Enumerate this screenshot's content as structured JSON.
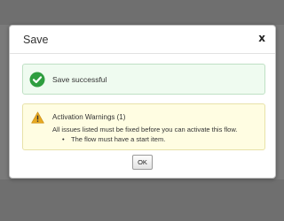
{
  "dialog": {
    "title": "Save",
    "close_label": "x"
  },
  "success": {
    "icon": "check-circle-icon",
    "text": "Save successful",
    "color": "#2e9e3f"
  },
  "warning": {
    "icon": "warning-triangle-icon",
    "title": "Activation Warnings (1)",
    "body": "All issues listed must be fixed before you can activate this flow.",
    "items": [
      "The flow must have a start item."
    ],
    "color": "#e7a923"
  },
  "ok_button": {
    "label": "OK"
  }
}
